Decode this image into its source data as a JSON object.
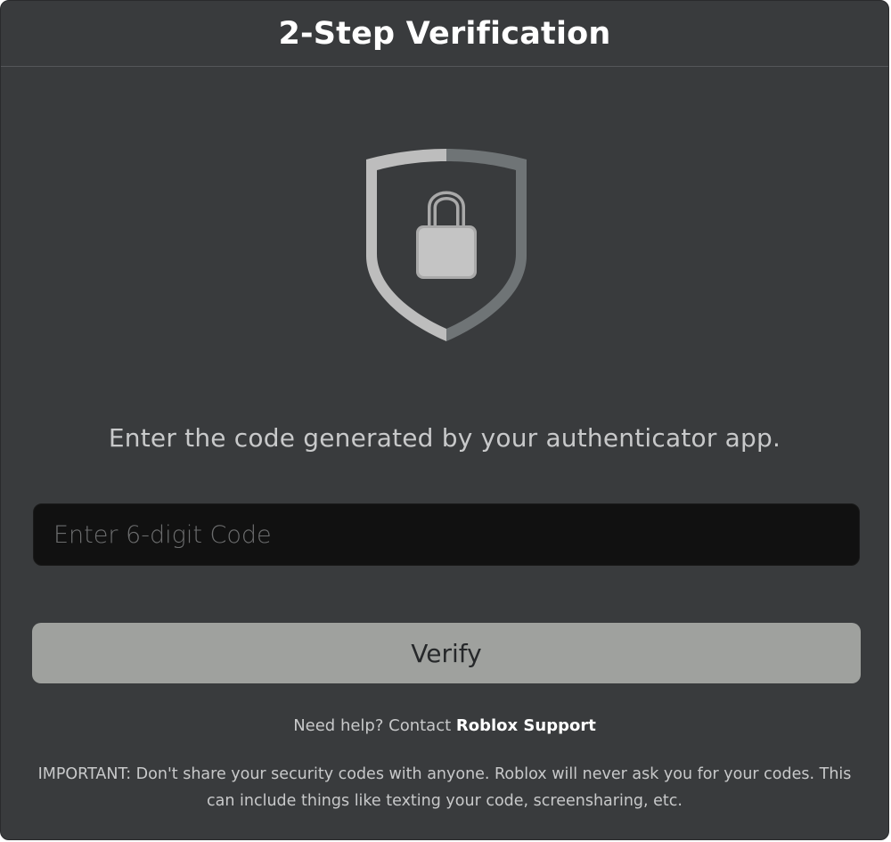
{
  "modal": {
    "title": "2-Step Verification"
  },
  "icon": {
    "name": "shield-lock-icon",
    "shield_light": "#bdbdbd",
    "shield_dark": "#6f7476",
    "lock_fill": "#c4c4c4"
  },
  "instruction": "Enter the code generated by your authenticator app.",
  "code_input": {
    "value": "",
    "placeholder": "Enter 6-digit Code"
  },
  "verify_button": {
    "label": "Verify"
  },
  "help": {
    "prefix": "Need help? Contact ",
    "link_label": "Roblox Support"
  },
  "important_notice": "IMPORTANT: Don't share your security codes with anyone. Roblox will never ask you for your codes. This can include things like texting your code, screensharing, etc.",
  "colors": {
    "background": "#393b3d",
    "input_background": "#111111",
    "button_background": "#9fa19e",
    "text_primary": "#ffffff",
    "text_secondary": "#c8c9ca"
  }
}
